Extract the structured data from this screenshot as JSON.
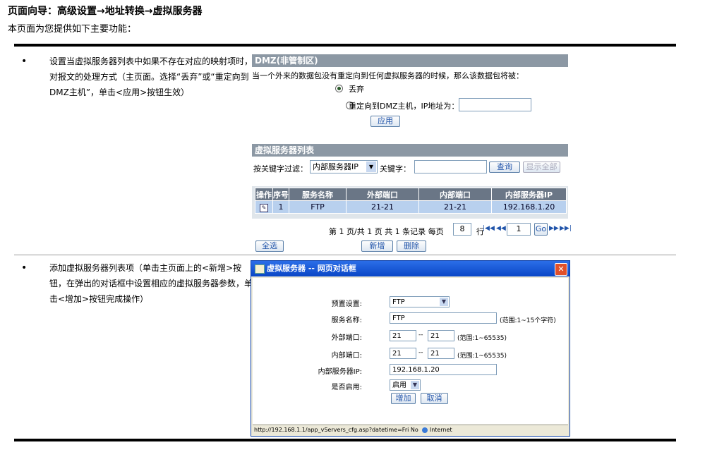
{
  "header": {
    "nav": "页面向导：高级设置→地址转换→虚拟服务器",
    "intro": "本页面为您提供如下主要功能："
  },
  "items": [
    {
      "bullet": "•",
      "text": "设置当虚拟服务器列表中如果不存在对应的映射项时，对报文的处理方式（主页面。选择“丢弃”或“重定向到DMZ主机”，单击<应用>按钮生效）"
    },
    {
      "bullet": "•",
      "text": "添加虚拟服务器列表项（单击主页面上的<新增>按钮，在弹出的对话框中设置相应的虚拟服务器参数，单击<增加>按钮完成操作）"
    }
  ],
  "dmz": {
    "title": "DMZ(非管制区)",
    "desc": "当一个外来的数据包没有重定向到任何虚拟服务器的时候，那么该数据包将被：",
    "opt1": "丢弃",
    "opt2": "重定向到DMZ主机，IP地址为：",
    "ip_value": "",
    "apply": "应用"
  },
  "list": {
    "title": "虚拟服务器列表",
    "filter_label": "按关键字过滤：",
    "filter_select": "内部服务器IP",
    "keyword_label": "关键字：",
    "keyword_value": "",
    "query": "查询",
    "show_all": "显示全部",
    "columns": [
      "操作",
      "序号",
      "服务名称",
      "外部端口",
      "内部端口",
      "内部服务器IP"
    ],
    "row": {
      "seq": "1",
      "name": "FTP",
      "ext": "21-21",
      "int": "21-21",
      "ip": "192.168.1.20"
    },
    "pager": "第 1 页/共 1 页 共 1 条记录 每页",
    "per_page": "8",
    "row_unit": "行",
    "page_input": "1",
    "go": "Go",
    "select_all": "全选",
    "add": "新增",
    "delete": "删除"
  },
  "dialog": {
    "title": "虚拟服务器 -- 网页对话框",
    "preset_label": "预置设置:",
    "preset_value": "FTP",
    "name_label": "服务名称:",
    "name_value": "FTP",
    "name_hint": "(范围:1~15个字符)",
    "ext_label": "外部端口:",
    "ext_from": "21",
    "ext_to": "21",
    "port_hint": "(范围:1~65535)",
    "int_label": "内部端口:",
    "int_from": "21",
    "int_to": "21",
    "ip_label": "内部服务器IP:",
    "ip_value": "192.168.1.20",
    "enable_label": "是否启用:",
    "enable_value": "启用",
    "dash": "--",
    "add": "增加",
    "cancel": "取消",
    "status": "http://192.168.1.1/app_vServers_cfg.asp?datetime=Fri No",
    "zone": "Internet"
  }
}
